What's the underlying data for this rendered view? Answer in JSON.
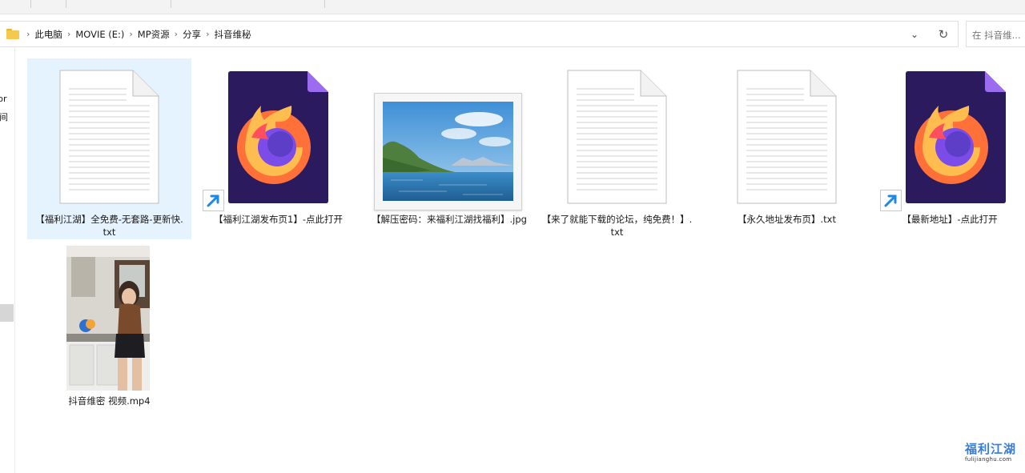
{
  "address_bar": {
    "breadcrumbs": [
      "此电脑",
      "MOVIE (E:)",
      "MP资源",
      "分享",
      "抖音维秘"
    ]
  },
  "search": {
    "placeholder": "在 抖音维..."
  },
  "left_pane": {
    "clipped_text_1": "rsor",
    "clipped_text_2": "间"
  },
  "files": [
    {
      "name_line1": "【福利江湖】全免费-无套路-更新快.",
      "name_line2": "txt",
      "icon": "text-document-icon",
      "selected": true
    },
    {
      "name_line1": "【福利江湖发布页1】-点此打开",
      "name_line2": "",
      "icon": "firefox-shortcut-icon",
      "selected": false
    },
    {
      "name_line1": "【解压密码：来福利江湖找福利】.jpg",
      "name_line2": "",
      "icon": "landscape-image-thumbnail",
      "selected": false
    },
    {
      "name_line1": "【来了就能下载的论坛，纯免费！】.",
      "name_line2": "txt",
      "icon": "text-document-icon",
      "selected": false
    },
    {
      "name_line1": "【永久地址发布页】.txt",
      "name_line2": "",
      "icon": "text-document-icon",
      "selected": false
    },
    {
      "name_line1": "【最新地址】-点此打开",
      "name_line2": "",
      "icon": "firefox-shortcut-icon",
      "selected": false
    },
    {
      "name_line1": "抖音维密 视频.mp4",
      "name_line2": "",
      "icon": "video-thumbnail",
      "selected": false
    }
  ],
  "watermark": {
    "title": "福利江湖",
    "subtitle": "fulijianghu.com"
  },
  "colors": {
    "selection": "#e5f3ff",
    "folder": "#f6c94e",
    "shortcut_arrow": "#1e88e5",
    "firefox_bg": "#2b1b5e"
  }
}
